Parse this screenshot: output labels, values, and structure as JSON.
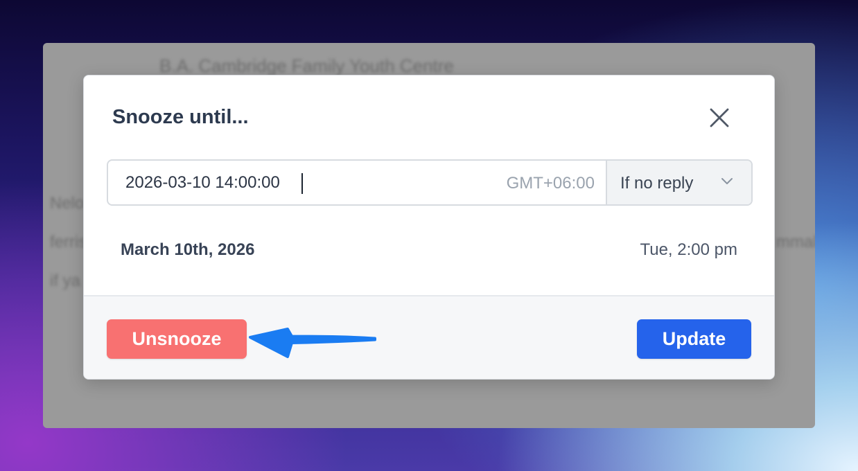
{
  "background": {
    "blurred_heading": "B.A. Cambridge Family Youth Centre",
    "blurred_fragments": [
      "Nelo",
      "ferris",
      "if ya",
      "mmal"
    ]
  },
  "modal": {
    "title": "Snooze until...",
    "close_icon": "close-icon",
    "datetime_value": "2026-03-10 14:00:00",
    "timezone": "GMT+06:00",
    "reply_condition": "If no reply",
    "reply_chevron_icon": "chevron-down-icon",
    "date_summary": "March 10th, 2026",
    "time_summary": "Tue, 2:00 pm",
    "unsnooze_label": "Unsnooze",
    "update_label": "Update"
  },
  "annotation": {
    "arrow_icon": "arrow-left-icon",
    "arrow_color": "#1a7cf2"
  },
  "colors": {
    "unsnooze": "#f87171",
    "update": "#2563eb",
    "title": "#2d3a4f"
  }
}
